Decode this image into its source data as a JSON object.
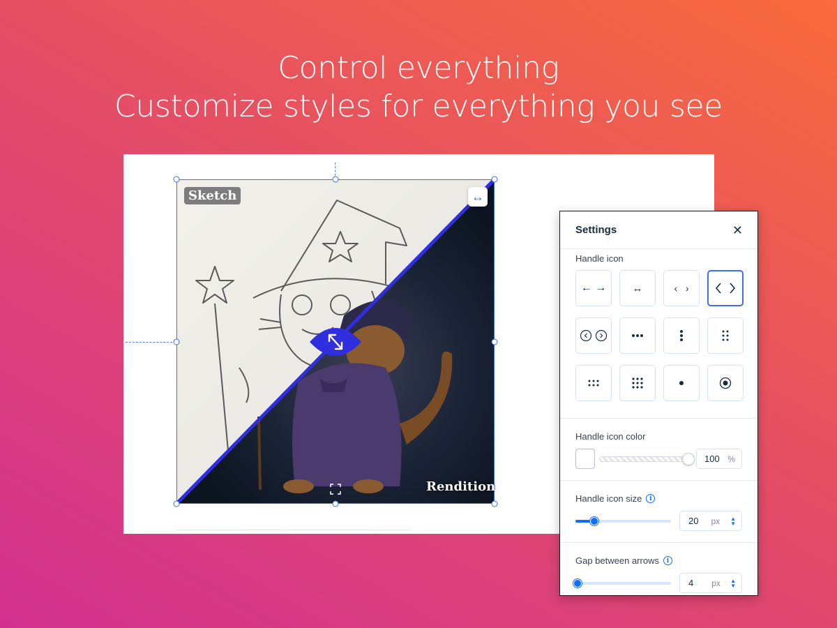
{
  "headline": {
    "line1": "Control everything",
    "line2": "Customize styles for everything you see"
  },
  "preview": {
    "label_before": "Sketch",
    "label_after": "Rendition",
    "swap_icon": "horizontal-double-arrow-icon",
    "handle_icon": "diagonal-resize-arrows-icon",
    "fullscreen_icon": "fullscreen-icon",
    "accent_color": "#3d6df2",
    "divider_color": "#2f2fe0"
  },
  "settings": {
    "title": "Settings",
    "close_icon": "close-icon",
    "handle_icon": {
      "label": "Handle icon",
      "options": [
        {
          "name": "arrows-long-icon",
          "glyph": "← →"
        },
        {
          "name": "arrows-double-icon",
          "glyph": "↔"
        },
        {
          "name": "chevrons-small-icon",
          "glyph": "‹  ›"
        },
        {
          "name": "chevrons-large-icon",
          "glyph": "〈 〉",
          "selected": true
        },
        {
          "name": "circled-chevrons-icon",
          "glyph": "circled"
        },
        {
          "name": "dots-horizontal-icon",
          "glyph": "•••"
        },
        {
          "name": "dots-vertical-icon",
          "glyph": "⋮"
        },
        {
          "name": "dots-grid-2x3-icon",
          "glyph": "⠿"
        },
        {
          "name": "dots-grid-3x2-icon",
          "glyph": "⠶"
        },
        {
          "name": "dots-grid-3x3-icon",
          "glyph": "⁙"
        },
        {
          "name": "single-dot-icon",
          "glyph": "•"
        },
        {
          "name": "target-dot-icon",
          "glyph": "⦿"
        }
      ]
    },
    "handle_icon_color": {
      "label": "Handle icon color",
      "swatch_color": "#ffffff",
      "opacity_value": "100",
      "opacity_unit": "%"
    },
    "handle_icon_size": {
      "label": "Handle icon size",
      "value": "20",
      "unit": "px",
      "slider_fraction": 0.2
    },
    "gap_between_arrows": {
      "label": "Gap between arrows",
      "value": "4",
      "unit": "px",
      "slider_fraction": 0.02
    }
  }
}
